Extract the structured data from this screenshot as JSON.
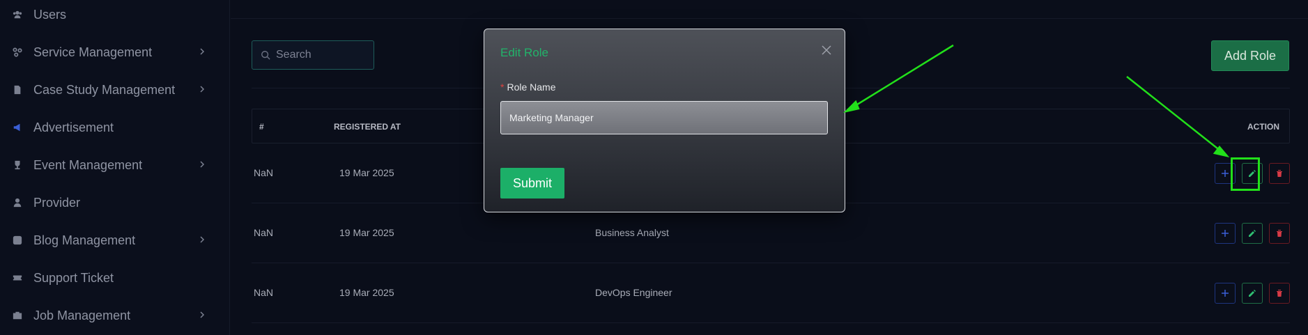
{
  "sidebar": {
    "items": [
      {
        "label": "Users",
        "icon": "users-icon",
        "chevron": false
      },
      {
        "label": "Service Management",
        "icon": "services-icon",
        "chevron": true
      },
      {
        "label": "Case Study Management",
        "icon": "document-icon",
        "chevron": true
      },
      {
        "label": "Advertisement",
        "icon": "megaphone-icon",
        "chevron": false
      },
      {
        "label": "Event Management",
        "icon": "trophy-icon",
        "chevron": true
      },
      {
        "label": "Provider",
        "icon": "provider-icon",
        "chevron": false
      },
      {
        "label": "Blog Management",
        "icon": "blog-icon",
        "chevron": true
      },
      {
        "label": "Support Ticket",
        "icon": "ticket-icon",
        "chevron": false
      },
      {
        "label": "Job Management",
        "icon": "briefcase-icon",
        "chevron": true
      }
    ]
  },
  "toolbar": {
    "search_placeholder": "Search",
    "add_role_label": "Add Role"
  },
  "table": {
    "headers": {
      "index": "#",
      "registered_at": "REGISTERED AT",
      "action": "ACTION"
    },
    "rows": [
      {
        "index": "NaN",
        "registered_at": "19 Mar 2025",
        "role": ""
      },
      {
        "index": "NaN",
        "registered_at": "19 Mar 2025",
        "role": "Business Analyst"
      },
      {
        "index": "NaN",
        "registered_at": "19 Mar 2025",
        "role": "DevOps Engineer"
      }
    ]
  },
  "modal": {
    "title": "Edit Role",
    "field_label": "Role Name",
    "required_mark": "*",
    "field_value": "Marketing Manager",
    "submit_label": "Submit"
  },
  "colors": {
    "accent_green": "#1caf68",
    "annotation_green": "#22e01a",
    "delete_red": "#d63a45",
    "add_blue": "#3b5fd6"
  }
}
